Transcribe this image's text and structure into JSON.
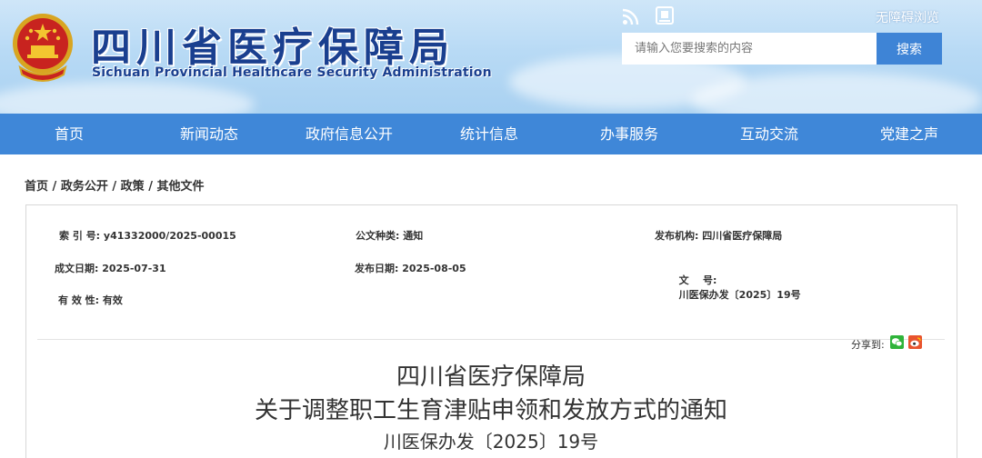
{
  "header": {
    "site_title": "四川省医疗保障局",
    "site_subtitle": "Sichuan Provincial Healthcare Security Administration",
    "accessible_label": "无障碍浏览",
    "search_placeholder": "请输入您要搜索的内容",
    "search_button_label": "搜索",
    "icons": [
      "emblem-icon",
      "rss-icon",
      "mobile-icon"
    ]
  },
  "nav": {
    "items": [
      {
        "label": "首页"
      },
      {
        "label": "新闻动态"
      },
      {
        "label": "政府信息公开"
      },
      {
        "label": "统计信息"
      },
      {
        "label": "办事服务"
      },
      {
        "label": "互动交流"
      },
      {
        "label": "党建之声"
      }
    ]
  },
  "breadcrumb": {
    "items": [
      "首页",
      "政务公开",
      "政策",
      "其他文件"
    ],
    "separator": " / "
  },
  "meta": {
    "index_no": {
      "label": "索 引 号:",
      "value": "y41332000/2025-00015"
    },
    "doc_type": {
      "label": "公文种类:",
      "value": "通知"
    },
    "issuer": {
      "label": "发布机构:",
      "value": "四川省医疗保障局"
    },
    "written_date": {
      "label": "成文日期:",
      "value": "2025-07-31"
    },
    "publish_date": {
      "label": "发布日期:",
      "value": "2025-08-05"
    },
    "doc_no": {
      "label": "文    号:",
      "value": "川医保办发〔2025〕19号"
    },
    "validity": {
      "label": "有 效 性:",
      "value": "有效"
    }
  },
  "share": {
    "label": "分享到:",
    "icons": [
      "wechat-icon",
      "weibo-icon"
    ]
  },
  "document": {
    "title_line1": "四川省医疗保障局",
    "title_line2": "关于调整职工生育津贴申领和发放方式的通知",
    "number": "川医保办发〔2025〕19号"
  },
  "colors": {
    "nav_bg": "#3f87d8",
    "search_button_bg": "#3e84d6",
    "title_blue": "#1a3f8f",
    "header_sky": "#b8daf5"
  }
}
